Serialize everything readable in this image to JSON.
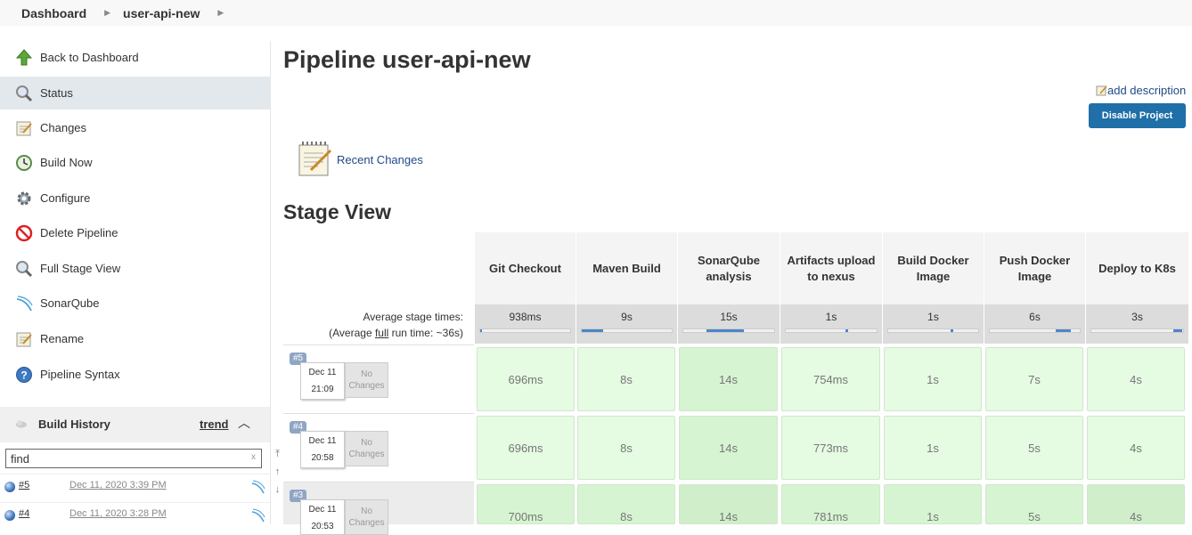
{
  "breadcrumb": {
    "items": [
      "Dashboard",
      "user-api-new"
    ]
  },
  "sidebar": {
    "tasks": [
      {
        "label": "Back to Dashboard",
        "icon": "up-arrow-icon"
      },
      {
        "label": "Status",
        "icon": "magnifier-icon"
      },
      {
        "label": "Changes",
        "icon": "notepad-icon"
      },
      {
        "label": "Build Now",
        "icon": "clock-icon"
      },
      {
        "label": "Configure",
        "icon": "gear-icon"
      },
      {
        "label": "Delete Pipeline",
        "icon": "no-entry-icon"
      },
      {
        "label": "Full Stage View",
        "icon": "magnifier-icon"
      },
      {
        "label": "SonarQube",
        "icon": "sonarqube-icon"
      },
      {
        "label": "Rename",
        "icon": "notepad-icon"
      },
      {
        "label": "Pipeline Syntax",
        "icon": "help-icon"
      }
    ],
    "active_task": "Status"
  },
  "build_history": {
    "title": "Build History",
    "trend_label": "trend",
    "search": {
      "value": "find",
      "clear": "x"
    },
    "builds": [
      {
        "number": "#5",
        "date": "Dec 11, 2020 3:39 PM"
      },
      {
        "number": "#4",
        "date": "Dec 11, 2020 3:28 PM"
      }
    ]
  },
  "main": {
    "title": "Pipeline user-api-new",
    "add_description": "add description",
    "disable_button": "Disable Project",
    "recent_changes": "Recent Changes",
    "stage_view_title": "Stage View"
  },
  "stage_view": {
    "avg_label_line1": "Average stage times:",
    "avg_label_prefix": "(Average ",
    "avg_label_link": "full",
    "avg_label_suffix": " run time: ~36s)",
    "stages": [
      "Git Checkout",
      "Maven Build",
      "SonarQube analysis",
      "Artifacts upload to nexus",
      "Build Docker Image",
      "Push Docker Image",
      "Deploy to K8s"
    ],
    "averages": [
      "938ms",
      "9s",
      "15s",
      "1s",
      "1s",
      "6s",
      "3s"
    ],
    "runs": [
      {
        "badge": "#5",
        "month_day": "Dec 11",
        "time": "21:09",
        "changes": "No Changes",
        "durations": [
          "696ms",
          "8s",
          "14s",
          "754ms",
          "1s",
          "7s",
          "4s"
        ]
      },
      {
        "badge": "#4",
        "month_day": "Dec 11",
        "time": "20:58",
        "changes": "No Changes",
        "durations": [
          "696ms",
          "8s",
          "14s",
          "773ms",
          "1s",
          "5s",
          "4s"
        ]
      },
      {
        "badge": "#3",
        "month_day": "Dec 11",
        "time": "20:53",
        "changes": "No Changes",
        "durations": [
          "700ms",
          "8s",
          "14s",
          "781ms",
          "1s",
          "5s",
          "4s"
        ]
      }
    ]
  },
  "colors": {
    "button_bg": "#1f6fa8",
    "link": "#204a87",
    "success_cell": "#e5fbe2",
    "progress": "#4a86c8"
  }
}
